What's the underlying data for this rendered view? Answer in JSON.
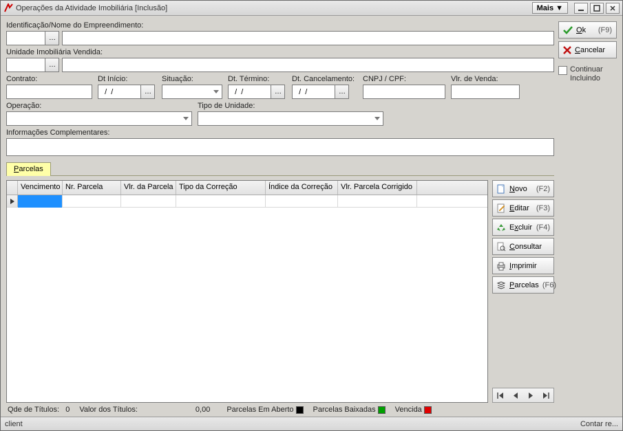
{
  "window": {
    "title": "Operações da Atividade Imobiliária [Inclusão]",
    "mais_label": "Mais"
  },
  "actions": {
    "ok_label": "Ok",
    "ok_shortcut": "(F9)",
    "cancel_label": "Cancelar",
    "continuar_l1": "Continuar",
    "continuar_l2": "Incluindo"
  },
  "labels": {
    "identificacao": "Identificação/Nome do Empreendimento:",
    "unidade": "Unidade Imobiliária Vendida:",
    "contrato": "Contrato:",
    "dt_inicio": "Dt Início:",
    "dt_inicio_value": "  /  /",
    "situacao": "Situação:",
    "dt_termino": "Dt. Término:",
    "dt_termino_value": "  /  /",
    "dt_cancel": "Dt. Cancelamento:",
    "dt_cancel_value": "  /  /",
    "cnpj": "CNPJ / CPF:",
    "vlr_venda": "Vlr. de Venda:",
    "operacao": "Operação:",
    "tipo_unidade": "Tipo de Unidade:",
    "info_compl": "Informações Complementares:"
  },
  "tab": {
    "parcelas": "Parcelas"
  },
  "grid": {
    "headers": {
      "vencimento": "Vencimento",
      "nr_parcela": "Nr. Parcela",
      "vlr_parcela": "Vlr. da Parcela",
      "tipo_correcao": "Tipo da Correção",
      "indice_correcao": "Índice da Correção",
      "vlr_corrigido": "Vlr. Parcela Corrigido"
    }
  },
  "grid_buttons": {
    "novo_label": "Novo",
    "novo_shortcut": "(F2)",
    "editar_label": "Editar",
    "editar_shortcut": "(F3)",
    "excluir_label": "Excluir",
    "excluir_shortcut": "(F4)",
    "consultar_label": "Consultar",
    "imprimir_label": "Imprimir",
    "parcelas_label": "Parcelas",
    "parcelas_shortcut": "(F6)"
  },
  "footer": {
    "qde_label": "Qde de Títulos:",
    "qde_value": "0",
    "valor_label": "Valor dos Títulos:",
    "valor_value": "0,00",
    "leg_aberto": "Parcelas Em Aberto",
    "leg_baixadas": "Parcelas Baixadas",
    "leg_vencida": "Vencida"
  },
  "statusbar": {
    "left": "client",
    "right": "Contar re..."
  },
  "colors": {
    "leg_aberto": "#000000",
    "leg_baixadas": "#00a000",
    "leg_vencida": "#e00000"
  }
}
